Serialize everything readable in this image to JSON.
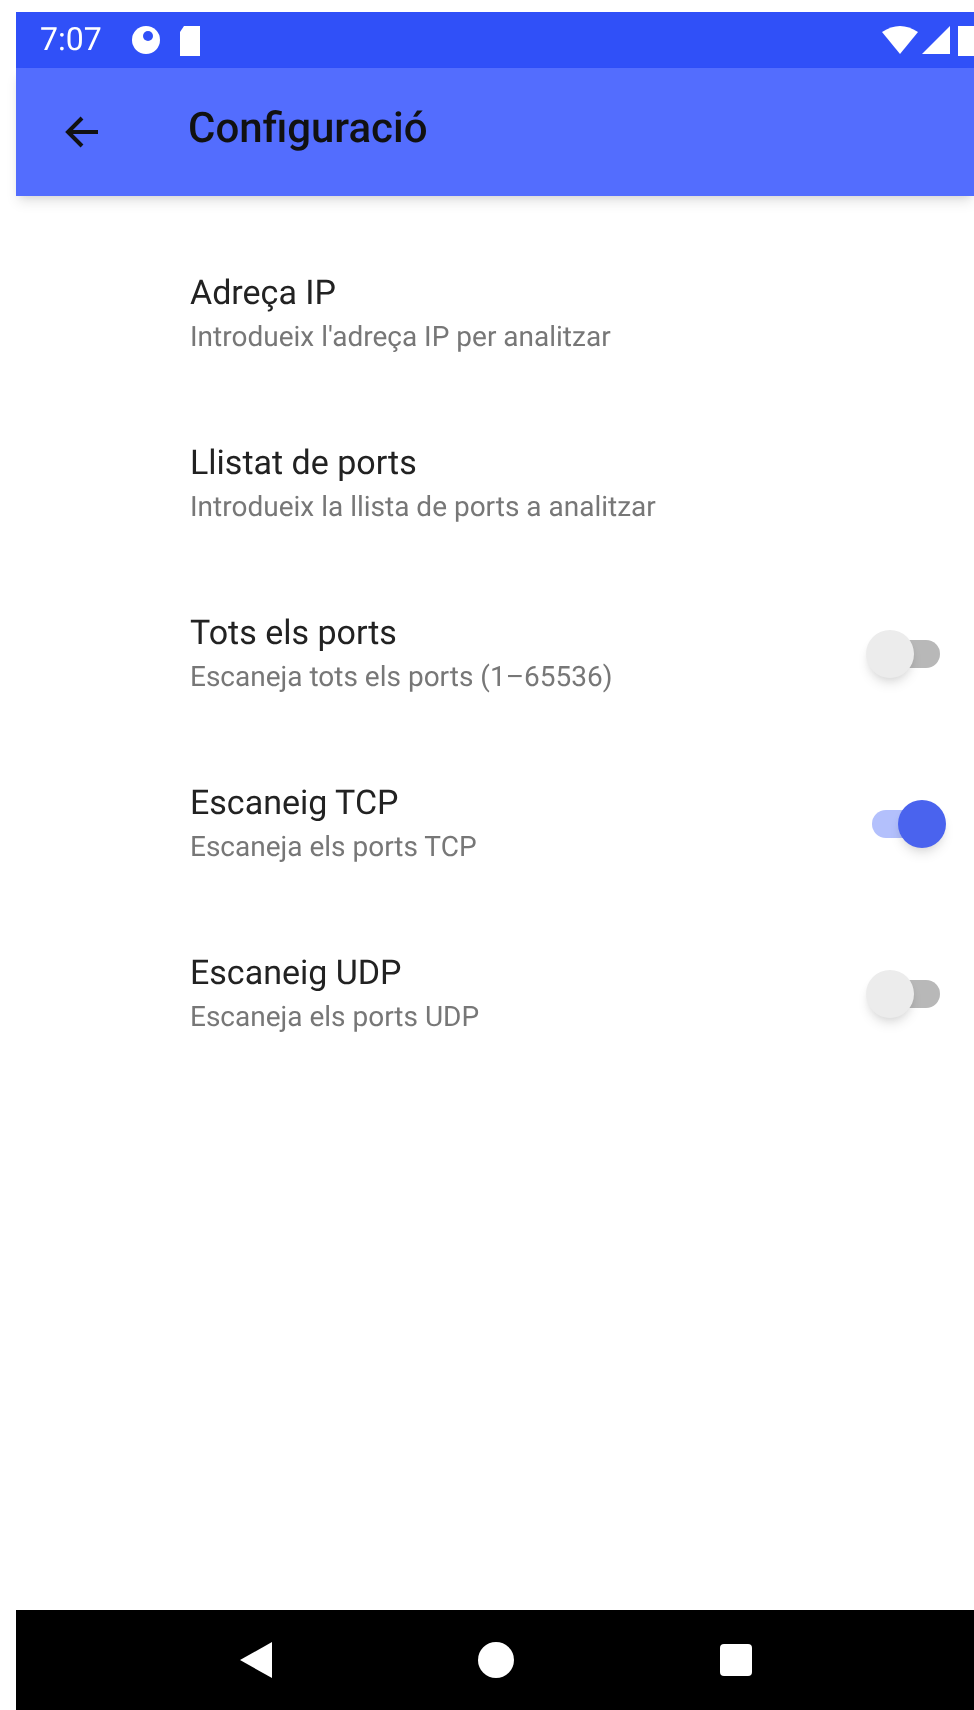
{
  "status_bar": {
    "time": "7:07"
  },
  "app_bar": {
    "title": "Configuració"
  },
  "settings": [
    {
      "kind": "text",
      "title": "Adreça IP",
      "summary": "Introdueix l'adreça IP per analitzar"
    },
    {
      "kind": "text",
      "title": "Llistat de ports",
      "summary": "Introdueix la llista de ports a analitzar"
    },
    {
      "kind": "switch",
      "title": "Tots els ports",
      "summary": "Escaneja tots els ports (1–65536)",
      "on": false
    },
    {
      "kind": "switch",
      "title": "Escaneig TCP",
      "summary": "Escaneja els ports TCP",
      "on": true
    },
    {
      "kind": "switch",
      "title": "Escaneig UDP",
      "summary": "Escaneja els ports UDP",
      "on": false
    }
  ]
}
